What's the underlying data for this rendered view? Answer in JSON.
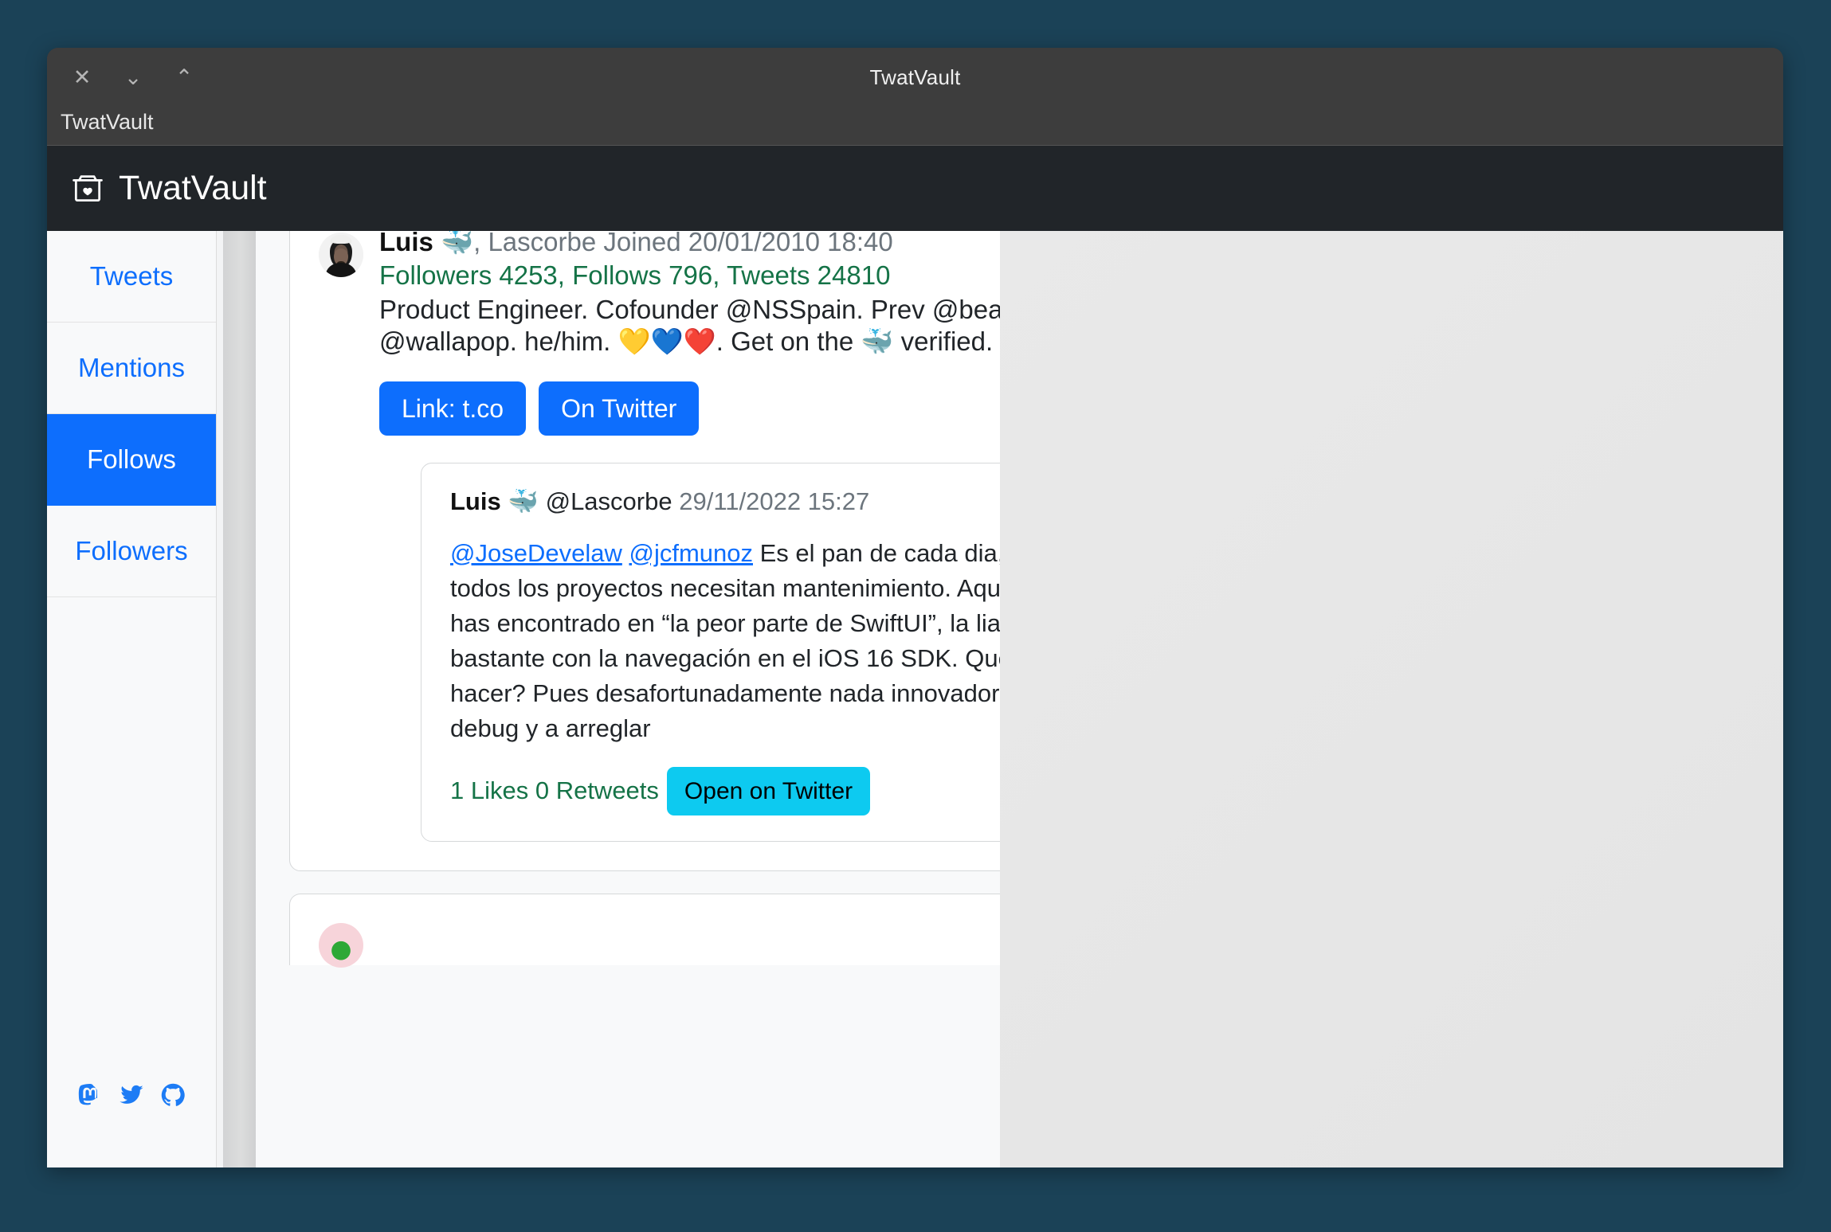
{
  "desktop": {
    "background": "#1b4257"
  },
  "window": {
    "title": "TwatVault",
    "subtitle": "TwatVault",
    "controls": [
      {
        "name": "close",
        "glyph": "✕"
      },
      {
        "name": "minimize",
        "glyph": "⌄"
      },
      {
        "name": "maximize",
        "glyph": "⌃"
      }
    ]
  },
  "navbar": {
    "brand": "TwatVault",
    "brand_icon": "archive-box-heart-icon",
    "background": "#212529"
  },
  "sidebar": {
    "items": [
      {
        "label": "Tweets",
        "active": false
      },
      {
        "label": "Mentions",
        "active": false
      },
      {
        "label": "Follows",
        "active": true
      },
      {
        "label": "Followers",
        "active": false
      }
    ],
    "active_color": "#0d6efd",
    "link_color": "#0d6efd",
    "social": [
      {
        "name": "mastodon-icon",
        "label": "Mastodon"
      },
      {
        "name": "twitter-icon",
        "label": "Twitter"
      },
      {
        "name": "github-icon",
        "label": "GitHub"
      }
    ]
  },
  "profile": {
    "display_name": "Luis",
    "emoji": "🐳",
    "handle_suffix": ", Lascorbe",
    "joined_label": "Joined",
    "joined_date": "20/01/2010 18:40",
    "stats": {
      "followers_label": "Followers",
      "followers": "4253",
      "follows_label": "Follows",
      "follows": "796",
      "tweets_label": "Tweets",
      "tweets": "24810",
      "line": "Followers 4253, Follows 796, Tweets 24810",
      "color": "#157347"
    },
    "bio": "Product Engineer. Cofounder @NSSpain. Prev @beamsfm, @wallapop. he/him. 💛💙❤️. Get on the 🐳 verified.",
    "buttons": [
      {
        "label": "Link: t.co",
        "name": "link-tco-button"
      },
      {
        "label": "On Twitter",
        "name": "on-twitter-button"
      }
    ]
  },
  "tweet": {
    "display_name": "Luis",
    "emoji": "🐳",
    "handle": "@Lascorbe",
    "timestamp": "29/11/2022 15:27",
    "mentions": [
      "@JoseDevelaw",
      "@jcfmunoz"
    ],
    "text": "Es el pan de cada dia, todos los proyectos necesitan mantenimiento. Aqui te has encontrado en “la peor parte de SwiftUI”, la liaron bastante con la navegación en el iOS 16 SDK. Que hacer? Pues desafortunadamente nada innovador, debug y a arreglar",
    "likes_retweets": "1 Likes 0 Retweets",
    "open_button": "Open on Twitter",
    "open_button_color": "#0dcaf0"
  }
}
